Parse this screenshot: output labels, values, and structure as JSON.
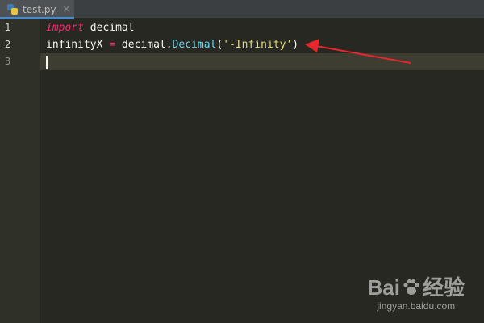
{
  "tab": {
    "title": "test.py",
    "close_glyph": "✕",
    "icon": "python-file-icon"
  },
  "editor": {
    "line_numbers": [
      "1",
      "2",
      "3"
    ],
    "lines": [
      {
        "tokens": [
          {
            "text": "import",
            "kind": "keyword"
          },
          {
            "text": " decimal",
            "kind": "plain"
          }
        ]
      },
      {
        "tokens": [
          {
            "text": "infinityX ",
            "kind": "plain"
          },
          {
            "text": "=",
            "kind": "operator"
          },
          {
            "text": " decimal.",
            "kind": "plain"
          },
          {
            "text": "Decimal",
            "kind": "class"
          },
          {
            "text": "(",
            "kind": "plain"
          },
          {
            "text": "'-Infinity'",
            "kind": "string"
          },
          {
            "text": ")",
            "kind": "plain"
          }
        ]
      },
      {
        "tokens": []
      }
    ],
    "current_line": 3
  },
  "colors": {
    "background": "#272822",
    "gutter": "#2f3129",
    "keyword": "#f92672",
    "class": "#66d9ef",
    "string": "#e6db74",
    "annotation_arrow": "#e8262c",
    "tab_accent": "#4a88c7"
  },
  "watermark": {
    "logo_left": "Bai",
    "logo_right": "经验",
    "url": "jingyan.baidu.com"
  }
}
